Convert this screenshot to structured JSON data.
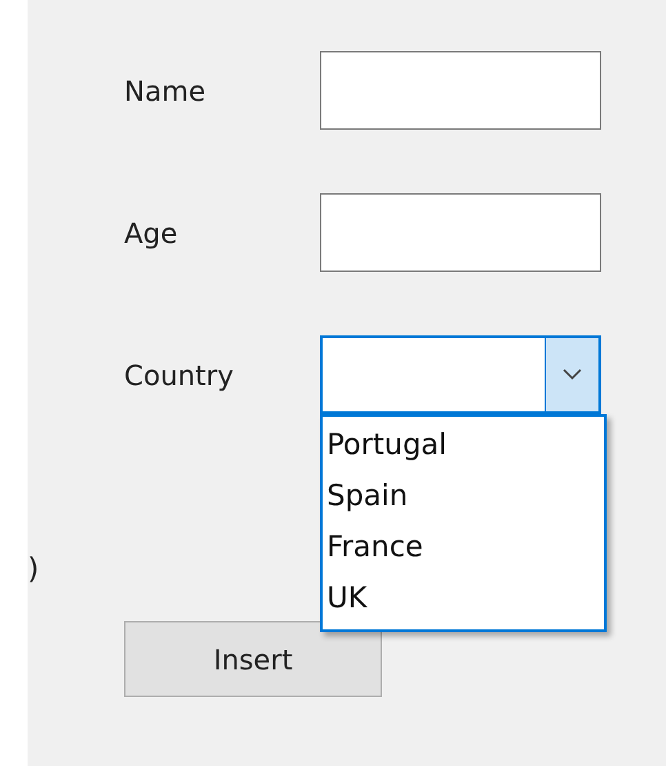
{
  "fields": [
    {
      "label": "Name"
    },
    {
      "label": "Age"
    }
  ],
  "country": {
    "label": "Country",
    "expanded": true,
    "options": [
      {
        "label": "Portugal",
        "selected": false
      },
      {
        "label": "Spain",
        "selected": false
      },
      {
        "label": "France",
        "selected": false
      },
      {
        "label": "UK",
        "selected": false
      }
    ]
  },
  "cut_text": ")",
  "buttons": [
    {
      "label": "Insert"
    }
  ]
}
